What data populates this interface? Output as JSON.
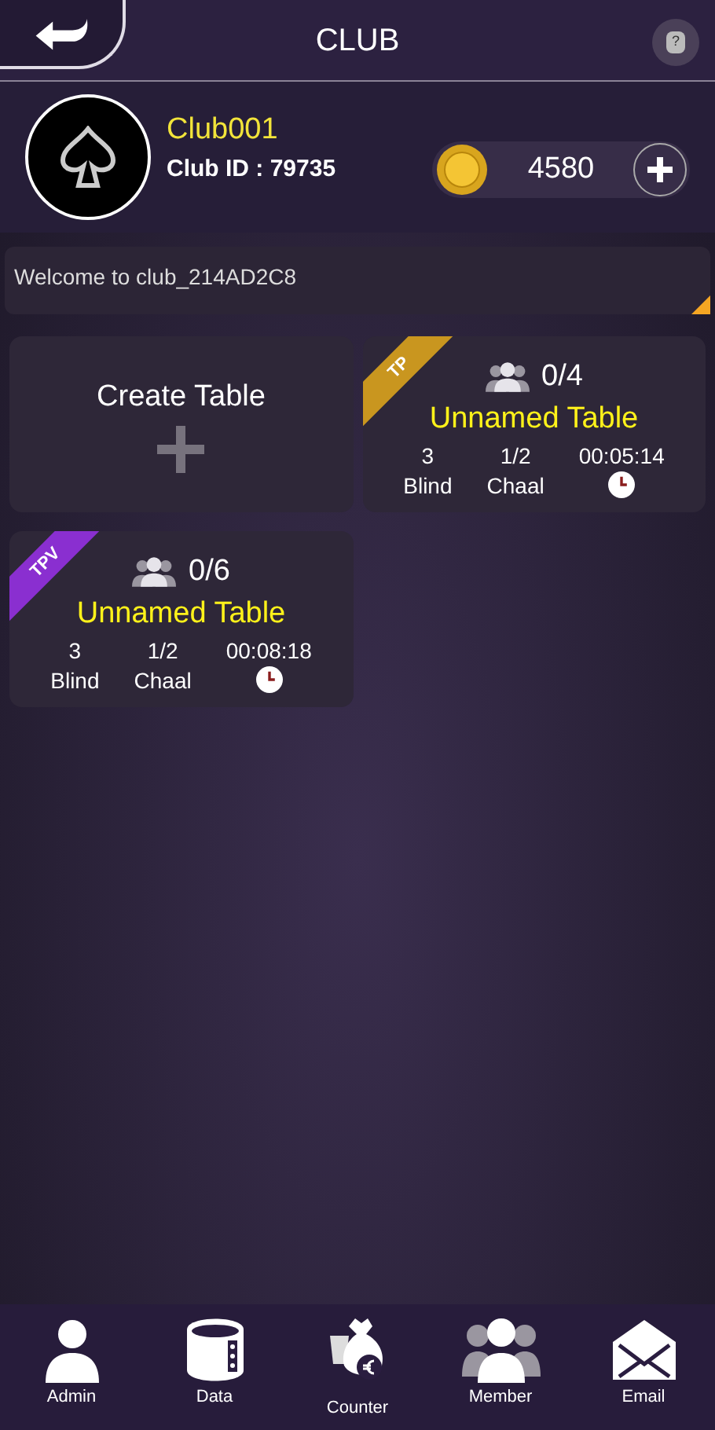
{
  "header": {
    "title": "CLUB",
    "help": "?"
  },
  "club": {
    "name": "Club001",
    "id_label": "Club ID : 79735",
    "coins": "4580"
  },
  "notice": "Welcome to club_214AD2C8",
  "tables": [
    {
      "kind": "create",
      "label": "Create Table"
    },
    {
      "kind": "table",
      "badge": "TP",
      "color": "#c9961f",
      "players": "0/4",
      "name": "Unnamed Table",
      "stats": [
        {
          "value": "3",
          "label": "Blind"
        },
        {
          "value": "1/2",
          "label": "Chaal"
        }
      ],
      "time": "00:05:14"
    },
    {
      "kind": "table",
      "badge": "TPV",
      "color": "#8a2fd0",
      "players": "0/6",
      "name": "Unnamed Table",
      "stats": [
        {
          "value": "3",
          "label": "Blind"
        },
        {
          "value": "1/2",
          "label": "Chaal"
        }
      ],
      "time": "00:08:18"
    }
  ],
  "nav": [
    {
      "kind": "admin",
      "label": "Admin"
    },
    {
      "kind": "data",
      "label": "Data"
    },
    {
      "kind": "counter",
      "label": "Counter"
    },
    {
      "kind": "member",
      "label": "Member"
    },
    {
      "kind": "email",
      "label": "Email"
    }
  ]
}
